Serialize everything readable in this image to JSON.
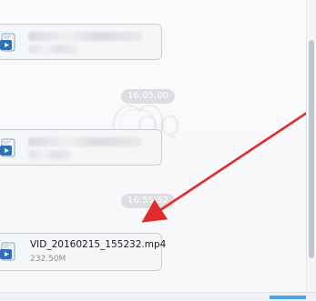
{
  "chat": {
    "messages": [
      {
        "type": "file",
        "blurred": true,
        "icon": "video-file-icon"
      },
      {
        "type": "timestamp",
        "text": "16:05:00"
      },
      {
        "type": "file",
        "blurred": true,
        "icon": "video-file-icon"
      },
      {
        "type": "timestamp",
        "text": "16:55:52"
      },
      {
        "type": "file",
        "blurred": false,
        "icon": "video-file-icon",
        "filename": "VID_20160215_155232.mp4",
        "filesize": "232.50M"
      }
    ]
  },
  "watermark": {
    "text": "QQ"
  },
  "colors": {
    "arrow": "#e12b2b",
    "bubble_border": "#c9ced6",
    "bubble_fill": "#f5f6f8",
    "timestamp_bg": "#dcdee2",
    "accent": "#4ea0ea"
  }
}
